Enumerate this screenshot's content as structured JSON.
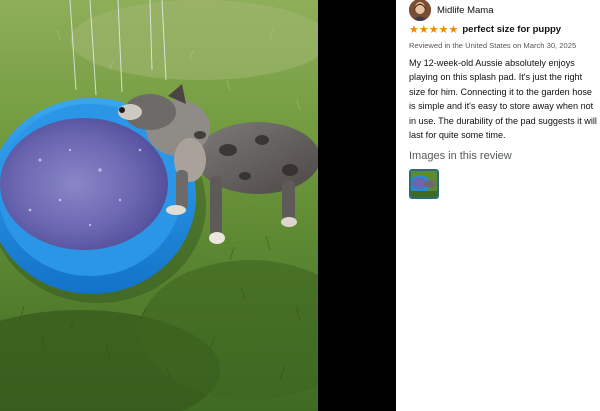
{
  "photo": {
    "icon": "review-photo-puppy-splash-pad"
  },
  "review": {
    "reviewer_name": "Midlife Mama",
    "rating": 5,
    "rating_max": 5,
    "title": "perfect size for puppy",
    "meta": "Reviewed in the United States on March 30, 2025",
    "body": "My 12-week-old Aussie absolutely enjoys playing on this splash pad. It's just the right size for him. Connecting it to the garden hose is simple and it's easy to store away when not in use. The durability of the pad suggests it will last for quite some time.",
    "images_heading": "Images in this review",
    "thumbnail_count": 1
  },
  "colors": {
    "star": "#f08804",
    "thumb_border": "#2a6b7a",
    "pool_blue": "#1e8fe0",
    "grass": "#5f8a34"
  }
}
